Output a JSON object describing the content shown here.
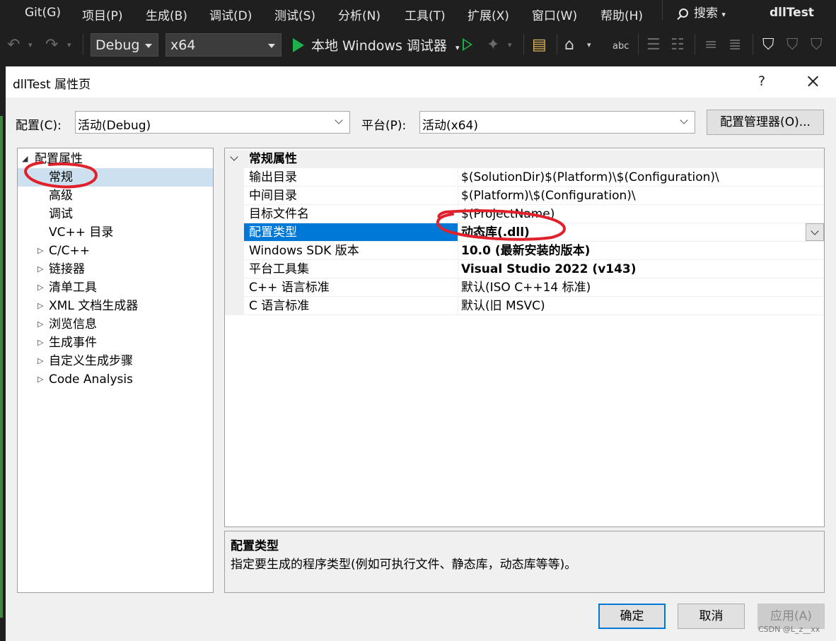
{
  "menubar": {
    "items": [
      "Git(G)",
      "项目(P)",
      "生成(B)",
      "调试(D)",
      "测试(S)",
      "分析(N)",
      "工具(T)",
      "扩展(X)",
      "窗口(W)",
      "帮助(H)"
    ],
    "search_label": "搜索",
    "app_title": "dllTest"
  },
  "toolbar": {
    "config_combo": "Debug",
    "platform_combo": "x64",
    "run_label": "本地 Windows 调试器"
  },
  "dialog": {
    "title": "dllTest 属性页",
    "help": "?",
    "config_label": "配置(C):",
    "config_value": "活动(Debug)",
    "platform_label": "平台(P):",
    "platform_value": "活动(x64)",
    "config_manager_button": "配置管理器(O)..."
  },
  "tree": {
    "root": "配置属性",
    "items": [
      {
        "label": "常规",
        "expandable": false,
        "selected": true
      },
      {
        "label": "高级",
        "expandable": false
      },
      {
        "label": "调试",
        "expandable": false
      },
      {
        "label": "VC++ 目录",
        "expandable": false
      },
      {
        "label": "C/C++",
        "expandable": true
      },
      {
        "label": "链接器",
        "expandable": true
      },
      {
        "label": "清单工具",
        "expandable": true
      },
      {
        "label": "XML 文档生成器",
        "expandable": true
      },
      {
        "label": "浏览信息",
        "expandable": true
      },
      {
        "label": "生成事件",
        "expandable": true
      },
      {
        "label": "自定义生成步骤",
        "expandable": true
      },
      {
        "label": "Code Analysis",
        "expandable": true
      }
    ]
  },
  "grid": {
    "category": "常规属性",
    "rows": [
      {
        "name": "输出目录",
        "value": "$(SolutionDir)$(Platform)\\$(Configuration)\\",
        "bold": false
      },
      {
        "name": "中间目录",
        "value": "$(Platform)\\$(Configuration)\\",
        "bold": false
      },
      {
        "name": "目标文件名",
        "value": "$(ProjectName)",
        "bold": false
      },
      {
        "name": "配置类型",
        "value": "动态库(.dll)",
        "bold": true,
        "selected": true
      },
      {
        "name": "Windows SDK 版本",
        "value": "10.0 (最新安装的版本)",
        "bold": true
      },
      {
        "name": "平台工具集",
        "value": "Visual Studio 2022 (v143)",
        "bold": true
      },
      {
        "name": "C++ 语言标准",
        "value": "默认(ISO C++14 标准)",
        "bold": false
      },
      {
        "name": "C 语言标准",
        "value": "默认(旧 MSVC)",
        "bold": false
      }
    ]
  },
  "description": {
    "title": "配置类型",
    "text": "指定要生成的程序类型(例如可执行文件、静态库，动态库等等)。"
  },
  "buttons": {
    "ok": "确定",
    "cancel": "取消",
    "apply": "应用(A)"
  },
  "watermark": "CSDN @L_z__xx",
  "colors": {
    "selection": "#0078d7",
    "annotation": "#e0202a",
    "run_green": "#1db04b"
  }
}
